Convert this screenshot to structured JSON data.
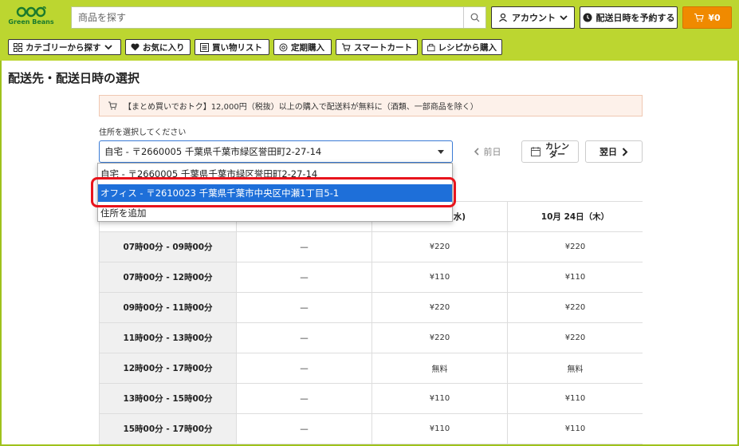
{
  "header": {
    "logo_text": "Green Beans",
    "search_placeholder": "商品を探す",
    "account_label": "アカウント",
    "reserve_label": "配送日時を予約する",
    "cart_label": "¥0"
  },
  "nav": {
    "items": [
      {
        "label": "カテゴリーから探す",
        "icon": "grid-icon"
      },
      {
        "label": "お気に入り",
        "icon": "heart-icon"
      },
      {
        "label": "買い物リスト",
        "icon": "list-icon"
      },
      {
        "label": "定期購入",
        "icon": "repeat-icon"
      },
      {
        "label": "スマートカート",
        "icon": "cart-icon"
      },
      {
        "label": "レシピから購入",
        "icon": "recipe-icon"
      }
    ]
  },
  "page": {
    "title": "配送先・配送日時の選択",
    "promo": "【まとめ買いでおトク】12,000円（税抜）以上の購入で配送料が無料に（酒類、一部商品を除く）",
    "address_label": "住所を選択してください",
    "address_selected": "自宅 - 〒2660005 千葉県千葉市緑区誉田町2-27-14",
    "address_options": [
      "自宅 - 〒2660005 千葉県千葉市緑区誉田町2-27-14",
      "オフィス - 〒2610023 千葉県千葉市中央区中瀬1丁目5-1",
      "住所を追加"
    ],
    "prev_label": "前日",
    "calendar_label": "カレンダー",
    "next_label": "翌日"
  },
  "table": {
    "headers": [
      "",
      "",
      "(水)",
      "10月 24日（木）"
    ],
    "rows": [
      {
        "slot": "07時00分 - 09時00分",
        "c1": "—",
        "c2": "¥220",
        "c3": "¥220"
      },
      {
        "slot": "07時00分 - 12時00分",
        "c1": "—",
        "c2": "¥110",
        "c3": "¥110"
      },
      {
        "slot": "09時00分 - 11時00分",
        "c1": "—",
        "c2": "¥220",
        "c3": "¥220"
      },
      {
        "slot": "11時00分 - 13時00分",
        "c1": "—",
        "c2": "¥220",
        "c3": "¥220"
      },
      {
        "slot": "12時00分 - 17時00分",
        "c1": "—",
        "c2": "無料",
        "c3": "無料"
      },
      {
        "slot": "13時00分 - 15時00分",
        "c1": "—",
        "c2": "¥110",
        "c3": "¥110"
      },
      {
        "slot": "15時00分 - 17時00分",
        "c1": "—",
        "c2": "¥110",
        "c3": "¥110"
      }
    ]
  },
  "colors": {
    "header_bg": "#bcd630",
    "cart_bg": "#f08a00",
    "selected_option": "#1e6fd9",
    "highlight": "#e8141c"
  }
}
